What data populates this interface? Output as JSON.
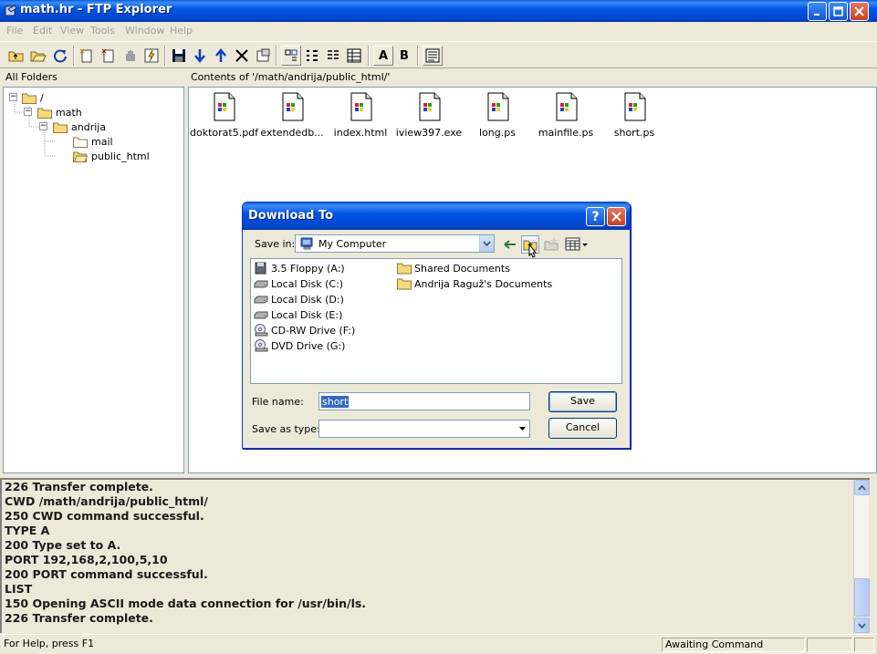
{
  "window": {
    "title": "math.hr - FTP Explorer"
  },
  "menu": [
    "File",
    "Edit",
    "View",
    "Tools",
    "Window",
    "Help"
  ],
  "toolbar": {
    "letter_a": "A",
    "letter_b": "B"
  },
  "left_pane": {
    "header": "All Folders",
    "tree": [
      {
        "label": "/",
        "depth": 0
      },
      {
        "label": "math",
        "depth": 1
      },
      {
        "label": "andrija",
        "depth": 2
      },
      {
        "label": "mail",
        "depth": 3
      },
      {
        "label": "public_html",
        "depth": 3
      }
    ]
  },
  "right_pane": {
    "header": "Contents of '/math/andrija/public_html/'",
    "files": [
      "doktorat5.pdf",
      "extendedb...",
      "index.html",
      "iview397.exe",
      "long.ps",
      "mainfile.ps",
      "short.ps"
    ]
  },
  "log": {
    "lines": [
      "226 Transfer complete.",
      "CWD /math/andrija/public_html/",
      "250 CWD command successful.",
      "TYPE A",
      "200 Type set to A.",
      "PORT 192,168,2,100,5,10",
      "200 PORT command successful.",
      "LIST",
      "150 Opening ASCII mode data connection for /usr/bin/ls.",
      "226 Transfer complete."
    ]
  },
  "status": {
    "help": "For Help, press F1",
    "state": "Awaiting Command"
  },
  "dialog": {
    "title": "Download To",
    "help_label": "?",
    "save_in_label": "Save in:",
    "save_in_value": "My Computer",
    "items_left": [
      {
        "label": "3.5 Floppy (A:)",
        "icon": "floppy-icon"
      },
      {
        "label": "Local Disk (C:)",
        "icon": "disk-icon"
      },
      {
        "label": "Local Disk (D:)",
        "icon": "disk-icon"
      },
      {
        "label": "Local Disk (E:)",
        "icon": "disk-icon"
      },
      {
        "label": "CD-RW Drive (F:)",
        "icon": "cd-icon"
      },
      {
        "label": "DVD Drive (G:)",
        "icon": "cd-icon"
      }
    ],
    "items_right": [
      {
        "label": "Shared Documents",
        "icon": "folder-icon"
      },
      {
        "label": "Andrija Raguž's Documents",
        "icon": "folder-icon"
      }
    ],
    "file_name_label": "File name:",
    "file_name_value": "short",
    "save_type_label": "Save as type:",
    "save_type_value": "",
    "save_button": "Save",
    "cancel_button": "Cancel"
  },
  "colors": {
    "titlebar": "#0055e5",
    "face": "#ece9d8",
    "selection": "#316ac5"
  }
}
